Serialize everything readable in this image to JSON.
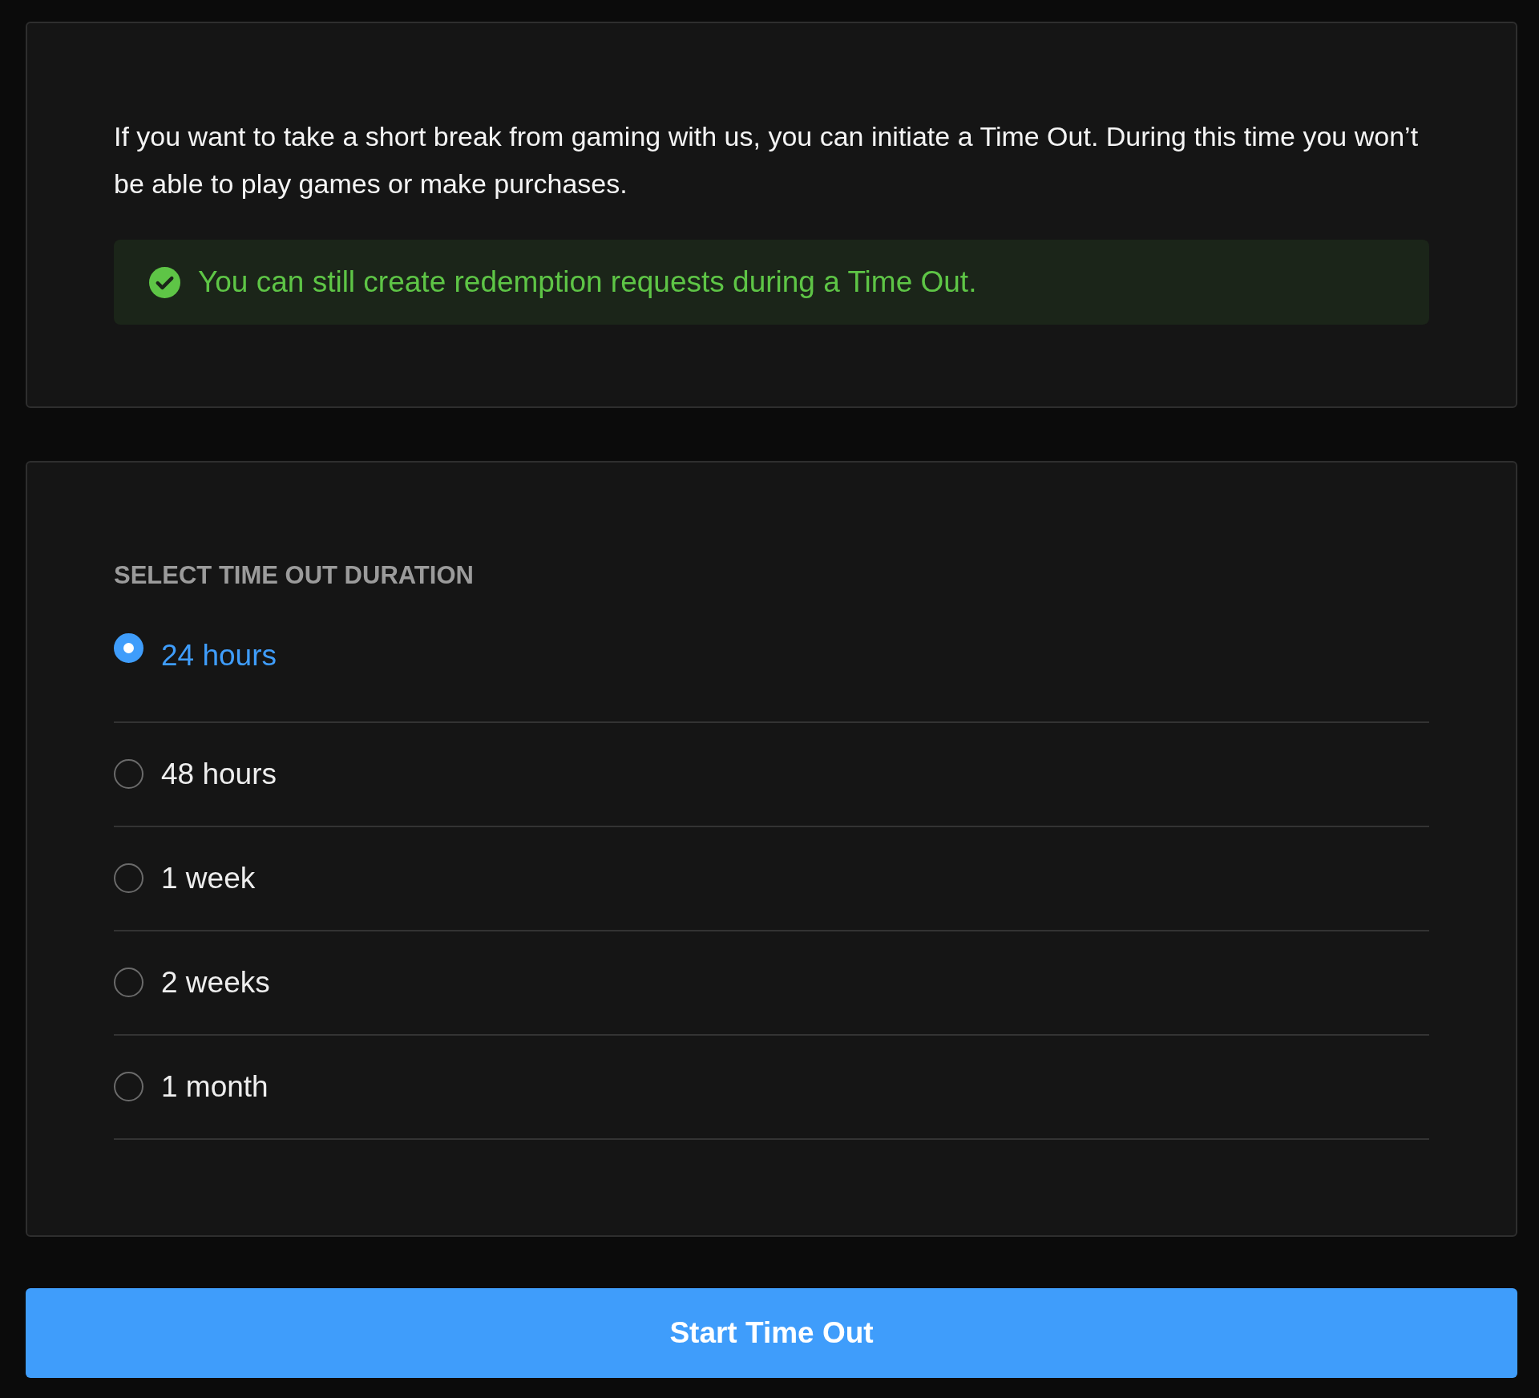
{
  "intro": {
    "text": "If you want to take a short break from gaming with us, you can initiate a Time Out. During this time you won’t be able to play games or make purchases."
  },
  "notice": {
    "text": "You can still create redemption requests during a Time Out."
  },
  "duration": {
    "heading": "SELECT TIME OUT DURATION",
    "options": [
      {
        "label": "24 hours",
        "selected": true
      },
      {
        "label": "48 hours",
        "selected": false
      },
      {
        "label": "1 week",
        "selected": false
      },
      {
        "label": "2 weeks",
        "selected": false
      },
      {
        "label": "1 month",
        "selected": false
      }
    ]
  },
  "button": {
    "label": "Start Time Out"
  }
}
